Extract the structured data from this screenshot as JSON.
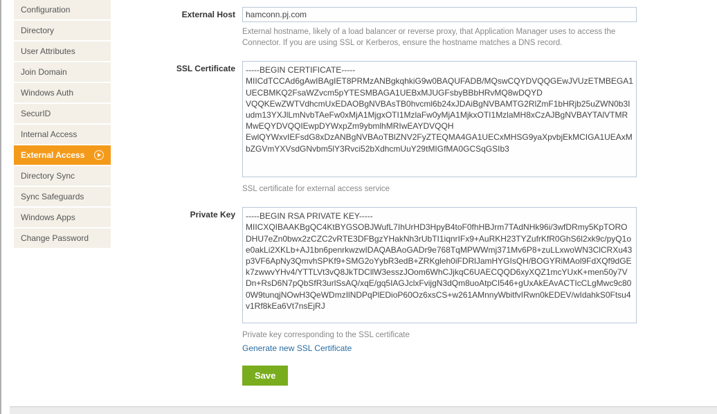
{
  "sidebar": {
    "items": [
      {
        "label": "Configuration"
      },
      {
        "label": "Directory"
      },
      {
        "label": "User Attributes"
      },
      {
        "label": "Join Domain"
      },
      {
        "label": "Windows Auth"
      },
      {
        "label": "SecurID"
      },
      {
        "label": "Internal Access"
      },
      {
        "label": "External Access"
      },
      {
        "label": "Directory Sync"
      },
      {
        "label": "Sync Safeguards"
      },
      {
        "label": "Windows Apps"
      },
      {
        "label": "Change Password"
      }
    ]
  },
  "form": {
    "external_host": {
      "label": "External Host",
      "value": "hamconn.pj.com",
      "help": "External hostname, likely of a load balancer or reverse proxy, that Application Manager uses to access the Connector. If you are using SSL or Kerberos, ensure the hostname matches a DNS record."
    },
    "ssl_cert": {
      "label": "SSL Certificate",
      "value": "-----BEGIN CERTIFICATE-----\nMIICdTCCAd6gAwIBAgIET8PRMzANBgkqhkiG9w0BAQUFADB/MQswCQYDVQQGEwJVUzETMBEGA1UECBMKQ2FsaWZvcm5pYTESMBAGA1UEBxMJUGFsbyBBbHRvMQ8wDQYD\nVQQKEwZWTVdhcmUxEDAOBgNVBAsTB0hvcml6b24xJDAiBgNVBAMTG2RlZmF1bHRjb25uZWN0b3Iudm13YXJlLmNvbTAeFw0xMjA1MjgxOTI1MzlaFw0yMjA1MjkxOTI1MzlaMH8xCzAJBgNVBAYTAlVTMRMwEQYDVQQIEwpDYWxpZm9ybmlhMRIwEAYDVQQH\nEwlQYWxvIEFsdG8xDzANBgNVBAoTBlZNV2FyZTEQMA4GA1UECxMHSG9yaXpvbjEkMCIGA1UEAxMbZGVmYXVsdGNvbm5lY3Rvci52bXdhcmUuY29tMIGfMA0GCSqGSIb3",
      "help": "SSL certificate for external access service"
    },
    "private_key": {
      "label": "Private Key",
      "value": "-----BEGIN RSA PRIVATE KEY-----\nMIICXQIBAAKBgQC4KtBYGSOBJWufL7IhUrHD3HpyB4toF0fhHBJrm7TAdNHk96i/3wfDRmy5KpTORODHU7eZn0bwx2zCZC2vRTE3DFBgzYHakNh3rUbTI1iqnrIFx9+AuRKH23TYZufrKfR0GhS6l2xk9c/pyQ1oe0akLi2XKLb+AJ1bn6penrkwzwIDAQABAoGADr9e768TqMPWWmj371Mv6P8+zuLLxwoWN3ClCRXu43p3VF6ApNy3QmvhSPKf9+SMG2oYybR3edB+ZRKgleh0iFDRlJamHYGIsQH/BOGYRiMAol9FdXQf9dGEk7zwwvYHv4/YTTLVt3vQ8JkTDCllW3esszJOom6WhCJjkqC6UAECQQD6xyXQZ1mcYUxK+men50y7VDn+RsD6N7pQbSfR3urlSsAQ/xqE/gq5IAGJclxFvijgN3dQm8uoAtpCI546+gUxAkEAvACTIcCLgMwc9c800W9tunqjNOwH3QeWDmzIlNDPqPlEDioP60Oz6xsCS+w261AMnnyWbitfvIRwn0kEDEV/wIdahkS0Ftsu4v1Rf8kEa6Vt7nsEjRJ",
      "help": "Private key corresponding to the SSL certificate"
    },
    "generate_link": "Generate new SSL Certificate",
    "save_label": "Save"
  }
}
